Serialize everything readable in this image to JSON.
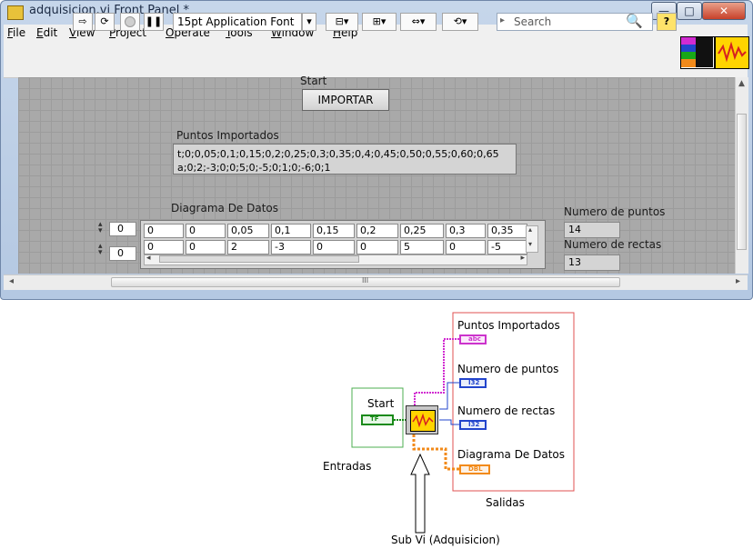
{
  "window": {
    "title": "adquisicion.vi Front Panel *",
    "minimize": "—",
    "maximize": "□",
    "close": "✕"
  },
  "menu": [
    "File",
    "Edit",
    "View",
    "Project",
    "Operate",
    "Tools",
    "Window",
    "Help"
  ],
  "toolbar": {
    "font": "15pt Application Font",
    "search_placeholder": "Search",
    "help": "?"
  },
  "front_panel": {
    "start_label": "Start",
    "importar_button": "IMPORTAR",
    "puntos_label": "Puntos Importados",
    "puntos_line1": "t;0;0,05;0,1;0,15;0,2;0,25;0,3;0,35;0,4;0,45;0,50;0,55;0,60;0,65",
    "puntos_line2": "a;0;2;-3;0;0;5;0;-5;0;1;0;-6;0;1",
    "diagrama_label": "Diagrama De Datos",
    "index_row": "0",
    "index_col": "0",
    "array_row1": [
      "0",
      "0",
      "0,05",
      "0,1",
      "0,15",
      "0,2",
      "0,25",
      "0,3",
      "0,35"
    ],
    "array_row2": [
      "0",
      "0",
      "2",
      "-3",
      "0",
      "0",
      "5",
      "0",
      "-5"
    ],
    "numero_puntos_label": "Numero de puntos",
    "numero_puntos_value": "14",
    "numero_rectas_label": "Numero de rectas",
    "numero_rectas_value": "13",
    "hscroll_thumb": "III"
  },
  "block_diagram": {
    "start_label": "Start",
    "start_terminal": "TF",
    "outputs": [
      {
        "label": "Puntos Importados",
        "terminal": "abc",
        "color": "#cc33cc"
      },
      {
        "label": "Numero de puntos",
        "terminal": "I32",
        "color": "#2244cc"
      },
      {
        "label": "Numero de rectas",
        "terminal": "I32",
        "color": "#2244cc"
      },
      {
        "label": "Diagrama De Datos",
        "terminal": "DBL",
        "color": "#f28a1a"
      }
    ],
    "entradas_label": "Entradas",
    "salidas_label": "Salidas",
    "subvi_label": "Sub Vi (Adquisicion)"
  }
}
